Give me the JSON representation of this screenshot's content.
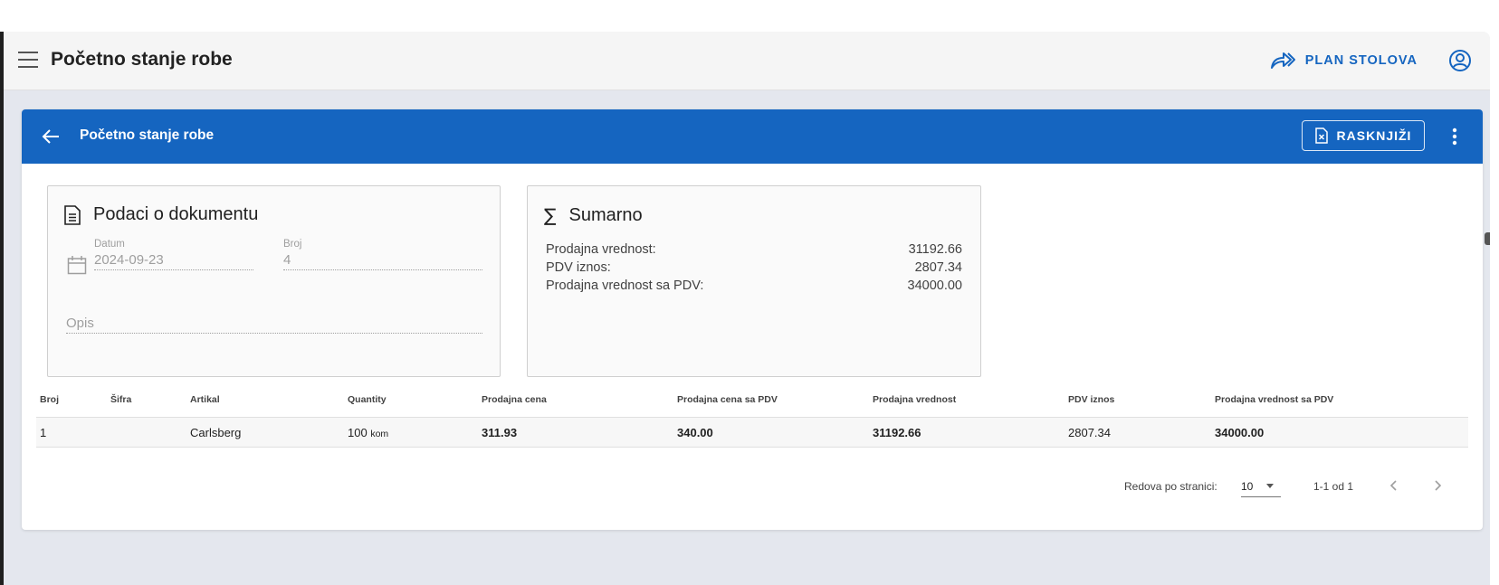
{
  "app_bar": {
    "title": "Početno stanje robe",
    "plan_button_label": "PLAN STOLOVA"
  },
  "card": {
    "title": "Početno stanje robe",
    "rasknjizi_label": "RASKNJIŽI"
  },
  "document_panel": {
    "title": "Podaci o dokumentu",
    "date_label": "Datum",
    "date_value": "2024-09-23",
    "number_label": "Broj",
    "number_value": "4",
    "description_placeholder": "Opis"
  },
  "summary_panel": {
    "title": "Sumarno",
    "rows": [
      {
        "label": "Prodajna vrednost:",
        "value": "31192.66"
      },
      {
        "label": "PDV iznos:",
        "value": "2807.34"
      },
      {
        "label": "Prodajna vrednost sa PDV:",
        "value": "34000.00"
      }
    ]
  },
  "table": {
    "columns": [
      "Broj",
      "Šifra",
      "Artikal",
      "Quantity",
      "Prodajna cena",
      "Prodajna cena sa PDV",
      "Prodajna vrednost",
      "PDV iznos",
      "Prodajna vrednost sa PDV"
    ],
    "rows": [
      {
        "broj": "1",
        "sifra": "",
        "artikal": "Carlsberg",
        "quantity": "100",
        "unit": "kom",
        "prodajna_cena": "311.93",
        "prodajna_cena_sa_pdv": "340.00",
        "prodajna_vrednost": "31192.66",
        "pdv_iznos": "2807.34",
        "prodajna_vrednost_sa_pdv": "34000.00"
      }
    ]
  },
  "pagination": {
    "rows_per_page_label": "Redova po stranici:",
    "rows_per_page_value": "10",
    "range_text": "1-1 od 1"
  },
  "colors": {
    "primary": "#1565c0",
    "background": "#e4e7ee"
  }
}
